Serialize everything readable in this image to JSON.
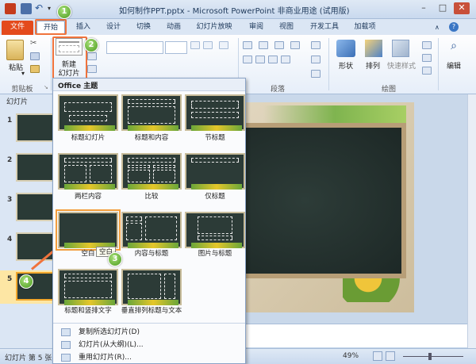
{
  "window": {
    "title": "如何制作PPT.pptx - Microsoft PowerPoint 非商业用途 (试用版)",
    "minimize": "–",
    "maximize": "□",
    "close": "✕"
  },
  "tabs": [
    "文件",
    "开始",
    "插入",
    "设计",
    "切换",
    "动画",
    "幻灯片放映",
    "审阅",
    "视图",
    "开发工具",
    "加载项"
  ],
  "ribbon": {
    "paste_label": "粘贴",
    "clipboard_group": "剪贴板",
    "new_slide_label_1": "新建",
    "new_slide_label_2": "幻灯片",
    "paragraph_group": "段落",
    "shape_label": "形状",
    "arrange_label": "排列",
    "quick_styles_label": "快速样式",
    "drawing_group": "绘图",
    "edit_label": "编辑"
  },
  "left_pane": {
    "tab_slides": "幻灯片",
    "slide_numbers": [
      "1",
      "2",
      "3",
      "4",
      "5"
    ]
  },
  "dropdown": {
    "header": "Office 主题",
    "layouts": [
      "标题幻灯片",
      "标题和内容",
      "节标题",
      "两栏内容",
      "比较",
      "仅标题",
      "空白",
      "内容与标题",
      "图片与标题",
      "标题和竖排文字",
      "垂直排列标题与文本"
    ],
    "tooltip": "空白",
    "commands": [
      "复制所选幻灯片(D)",
      "幻灯片(从大纲)(L)...",
      "重用幻灯片(R)..."
    ]
  },
  "status": {
    "slide_info": "幻灯片 第 5 张",
    "zoom": "49%"
  },
  "steps": [
    "1",
    "2",
    "3",
    "4"
  ],
  "colors": {
    "file_tab": "#e44a1c",
    "highlight": "#f0733c",
    "badge": "#4a9a1e"
  }
}
